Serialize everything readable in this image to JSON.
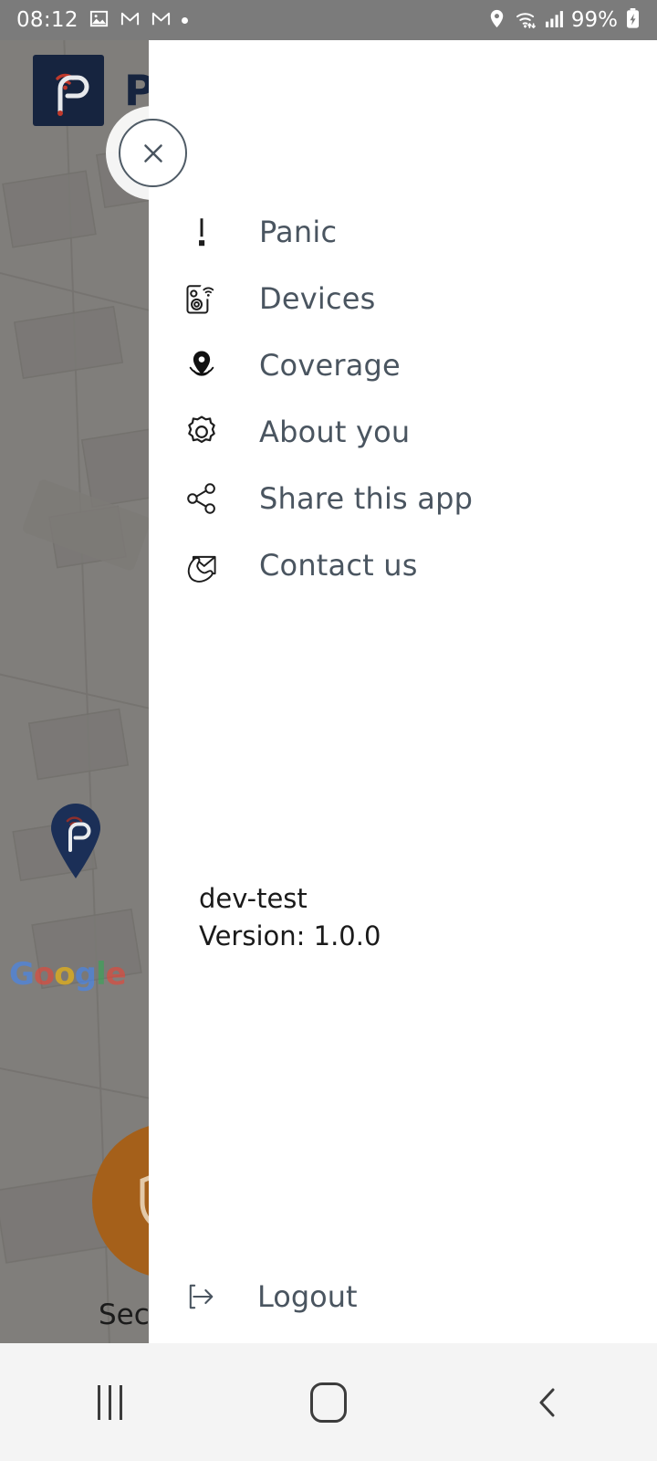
{
  "statusbar": {
    "clock": "08:12",
    "battery_percent": "99%",
    "icons": [
      "image-icon",
      "gmail-icon",
      "gmail-icon",
      "dot-icon",
      "location-icon",
      "wifi-icon",
      "cellular-signal-icon",
      "battery-charging-icon"
    ]
  },
  "map": {
    "app_title": "P",
    "app_logo_name": "app-logo-icon",
    "attribution": "Google",
    "attribution_letters": [
      "G",
      "o",
      "o",
      "g",
      "l",
      "e"
    ],
    "pin_name": "map-location-pin",
    "fab_label": "Sec",
    "fab_icon": "shield-icon",
    "fab_color": "#a5601a",
    "scrim_color": "rgba(60,60,60,0.55)",
    "brand_navy": "#16243f"
  },
  "drawer": {
    "close_button_label": "close-icon",
    "items": [
      {
        "label": "Panic",
        "icon": "exclamation-mark-icon"
      },
      {
        "label": "Devices",
        "icon": "device-wifi-icon"
      },
      {
        "label": "Coverage",
        "icon": "location-pin-signal-icon"
      },
      {
        "label": "About you",
        "icon": "gear-icon"
      },
      {
        "label": "Share this app",
        "icon": "share-nodes-icon"
      },
      {
        "label": "Contact us",
        "icon": "envelope-phone-icon"
      }
    ],
    "version": {
      "environment": "dev-test",
      "version_line": "Version: 1.0.0"
    },
    "logout": {
      "label": "Logout",
      "icon": "logout-arrow-icon"
    },
    "text_color": "#4a5560"
  },
  "navbar": {
    "buttons": [
      {
        "name": "recents",
        "icon": "recents-icon"
      },
      {
        "name": "home",
        "icon": "home-icon"
      },
      {
        "name": "back",
        "icon": "back-chevron-icon"
      }
    ]
  }
}
